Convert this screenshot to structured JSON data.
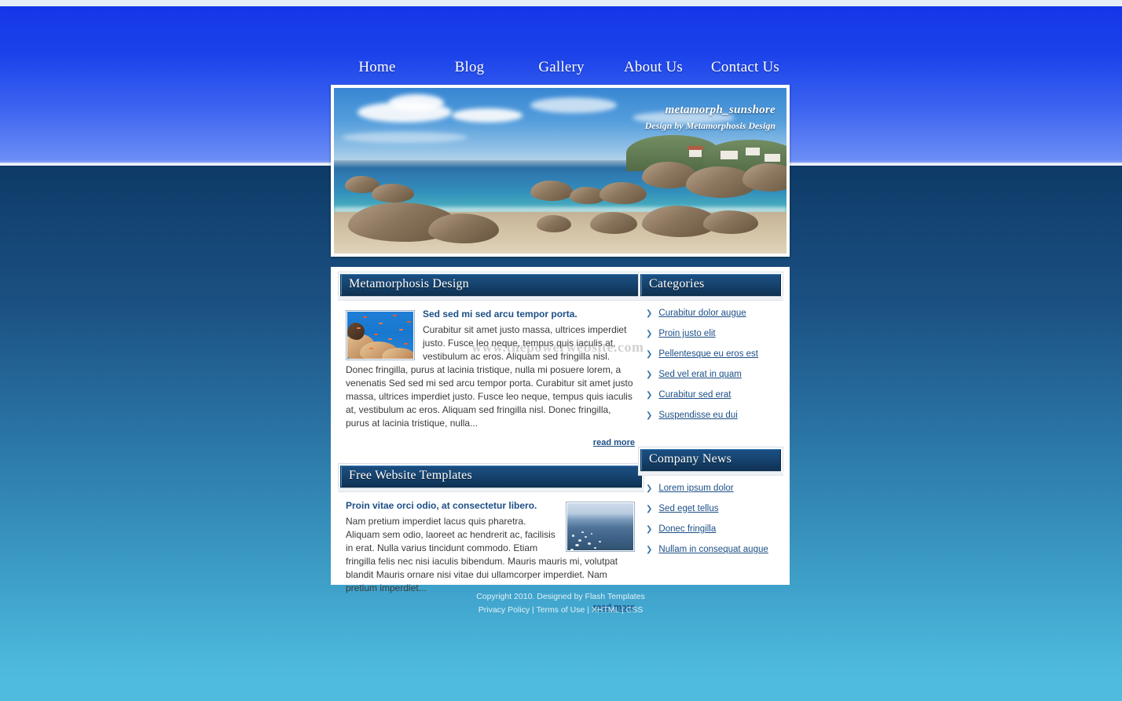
{
  "nav": {
    "items": [
      {
        "label": "Home"
      },
      {
        "label": "Blog"
      },
      {
        "label": "Gallery"
      },
      {
        "label": "About Us"
      },
      {
        "label": "Contact Us"
      }
    ]
  },
  "banner": {
    "title": "metamorph_sunshore",
    "subtitle": "Design by Metamorphosis Design"
  },
  "watermark": "www.thepowerwebsite.com",
  "panels": {
    "main": {
      "title": "Metamorphosis Design",
      "article": {
        "heading": "Sed sed mi sed arcu tempor porta.",
        "body": "Curabitur sit amet justo massa, ultrices imperdiet justo. Fusce leo neque, tempus quis iaculis at, vestibulum ac eros. Aliquam sed fringilla nisl. Donec fringilla, purus at lacinia tristique, nulla mi posuere lorem, a venenatis Sed sed mi sed arcu tempor porta. Curabitur sit amet justo massa, ultrices imperdiet justo. Fusce leo neque, tempus quis iaculis at, vestibulum ac eros. Aliquam sed fringilla nisl. Donec fringilla, purus at lacinia tristique, nulla...",
        "read_more": "read more",
        "thumb_name": "coral-reef-thumbnail"
      }
    },
    "templates": {
      "title": "Free Website Templates",
      "article": {
        "heading": "Proin vitae orci odio, at consectetur libero.",
        "body": "Nam pretium imperdiet lacus quis pharetra. Aliquam sem odio, laoreet ac hendrerit ac, facilisis in erat. Nulla varius tincidunt commodo. Etiam fringilla felis nec nisi iaculis bibendum. Mauris mauris mi, volutpat blandit Mauris ornare nisi vitae dui ullamcorper imperdiet. Nam pretium imperdiet...",
        "read_more": "read more",
        "thumb_name": "ocean-horizon-thumbnail"
      }
    },
    "categories": {
      "title": "Categories",
      "links": [
        {
          "label": "Curabitur dolor augue"
        },
        {
          "label": "Proin justo elit"
        },
        {
          "label": "Pellentesque eu eros est"
        },
        {
          "label": "Sed vel erat in quam"
        },
        {
          "label": "Curabitur sed erat"
        },
        {
          "label": "Suspendisse eu dui"
        }
      ]
    },
    "company_news": {
      "title": "Company News",
      "links": [
        {
          "label": "Lorem ipsum dolor"
        },
        {
          "label": "Sed eget tellus"
        },
        {
          "label": "Donec fringilla"
        },
        {
          "label": "Nullam in consequat augue"
        }
      ]
    }
  },
  "footer": {
    "copyright": "Copyright 2010. Designed by Flash Templates",
    "links_line": "Privacy Policy | Terms of Use | XHTML | CSS"
  },
  "colors": {
    "header_blue": "#1436e8",
    "header_blue_light": "#6a8cf5",
    "body_navy": "#11406e",
    "body_cyan": "#4fbcdf",
    "panel_head": "#174672",
    "link_blue": "#1c4f86"
  }
}
